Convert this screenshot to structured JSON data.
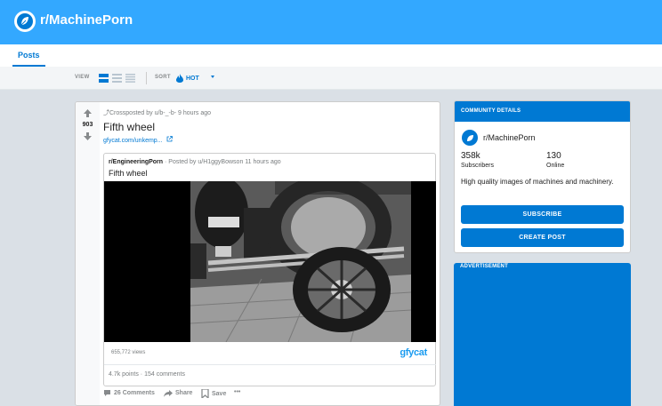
{
  "header": {
    "subreddit": "r/MachinePorn",
    "logo_icon": "leaf-icon"
  },
  "tabs": [
    {
      "label": "Posts",
      "active": true
    }
  ],
  "viewbar": {
    "view_label": "VIEW",
    "sort_label": "SORT",
    "sort_value": "HOT",
    "view_icons": [
      "card-view-icon",
      "classic-view-icon",
      "compact-view-icon"
    ]
  },
  "post": {
    "score": "903",
    "crosspost_text": "Crossposted by u/b-_-b- 9 hours ago",
    "title": "Fifth wheel",
    "link": "gfycat.com/unkemp...",
    "original": {
      "subreddit": "r/EngineeringPorn",
      "meta": " · Posted by u/H1ggyBowson 11 hours ago",
      "title": "Fifth wheel",
      "views": "655,772 views",
      "brand": "gfycat",
      "stats": "4.7k points · 154 comments"
    },
    "actions": {
      "comments": "26 Comments",
      "share": "Share",
      "save": "Save",
      "more": "•••"
    }
  },
  "sidebar": {
    "header": "COMMUNITY DETAILS",
    "name": "r/MachinePorn",
    "subscribers_value": "358k",
    "subscribers_label": "Subscribers",
    "online_value": "130",
    "online_label": "Online",
    "description": "High quality images of machines and machinery.",
    "subscribe_label": "SUBSCRIBE",
    "create_post_label": "CREATE POST"
  },
  "ad": {
    "label": "ADVERTISEMENT"
  },
  "colors": {
    "banner": "#33a8ff",
    "primary": "#0079d3",
    "background": "#dae0e6"
  }
}
